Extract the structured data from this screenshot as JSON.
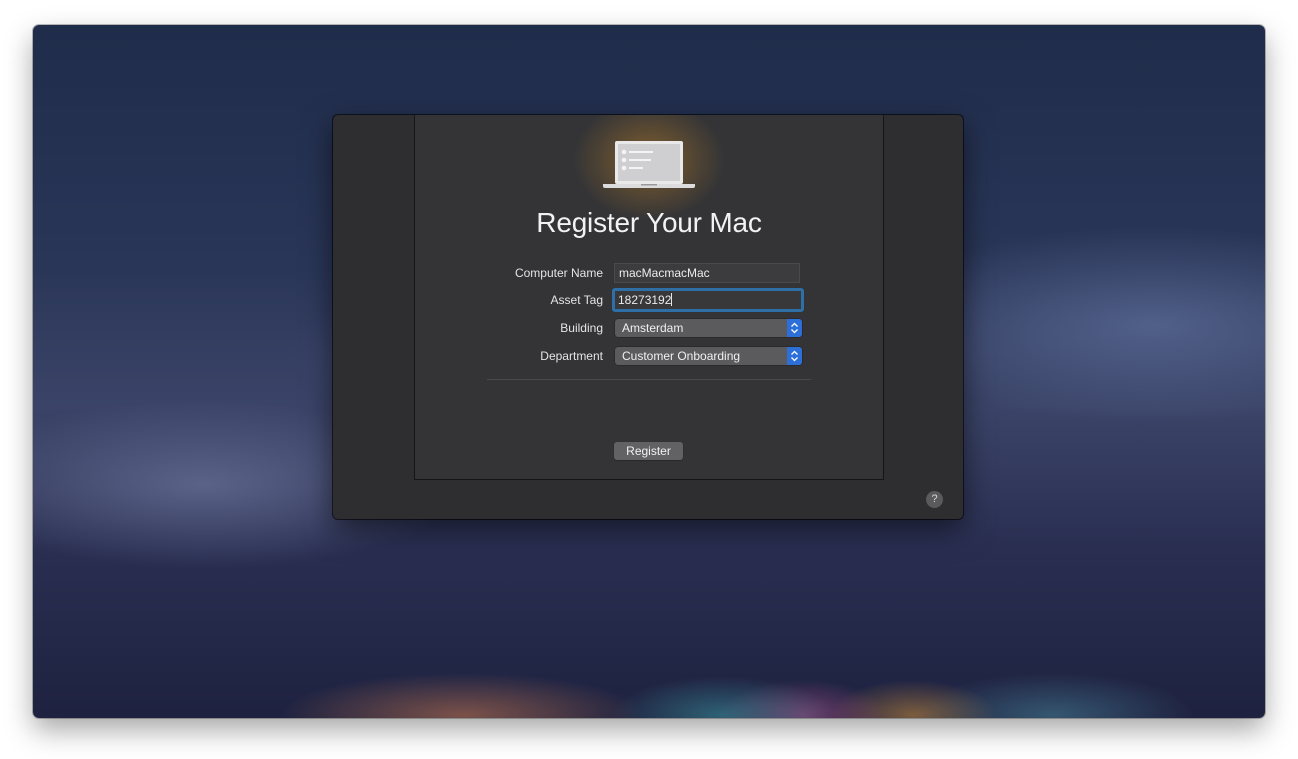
{
  "dialog": {
    "title": "Register Your Mac",
    "icon": "laptop-checklist-icon"
  },
  "form": {
    "computer_name": {
      "label": "Computer Name",
      "value": "macMacmacMac"
    },
    "asset_tag": {
      "label": "Asset Tag",
      "value": "18273192"
    },
    "building": {
      "label": "Building",
      "selected": "Amsterdam"
    },
    "department": {
      "label": "Department",
      "selected": "Customer Onboarding"
    }
  },
  "buttons": {
    "register": "Register",
    "help": "?"
  },
  "colors": {
    "focus_ring": "#2f6fa7",
    "popup_stepper": "#2c6fd9",
    "panel_background": "#343436"
  }
}
